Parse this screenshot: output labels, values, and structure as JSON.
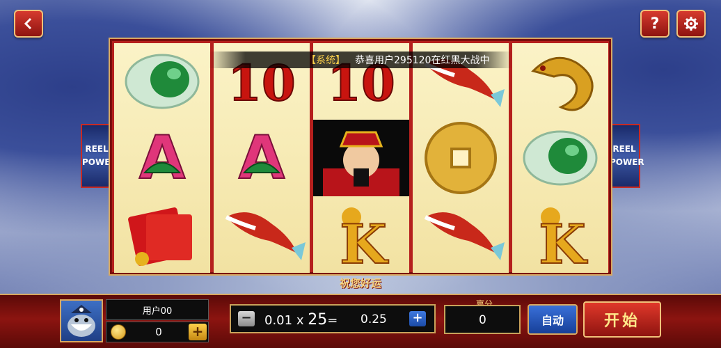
{
  "nav": {
    "back_icon": "back-arrow-icon",
    "help_label": "?",
    "settings_icon": "gear-icon"
  },
  "marquee": {
    "tag": "【系统】",
    "message": "恭喜用户295120在红黑大战中"
  },
  "side_badge": {
    "line1": "REEL",
    "line2": "POWER"
  },
  "reels": [
    [
      "jade-bracelet",
      "letter-a",
      "red-envelope"
    ],
    [
      "ten",
      "letter-a",
      "koi-fish"
    ],
    [
      "ten",
      "god-of-wealth",
      "letter-k"
    ],
    [
      "koi-fish",
      "gold-coin",
      "koi-fish"
    ],
    [
      "golden-dragon",
      "jade-bracelet",
      "letter-k"
    ]
  ],
  "symbol_text": {
    "ten": "10",
    "letter-a": "A",
    "letter-k": "K"
  },
  "footer": {
    "luck_text": "祝您好运",
    "username": "用户00",
    "coins": "0",
    "bet_per_line": "0.01",
    "multiply": "x",
    "lines": "25",
    "equals": "=",
    "total_bet": "0.25",
    "win_label": "赢分",
    "win_value": "0",
    "auto_label": "自动",
    "spin_label": "开始"
  },
  "colors": {
    "accent_red": "#b5201d",
    "gold": "#d9a860",
    "blue_button": "#1b4aa6"
  }
}
